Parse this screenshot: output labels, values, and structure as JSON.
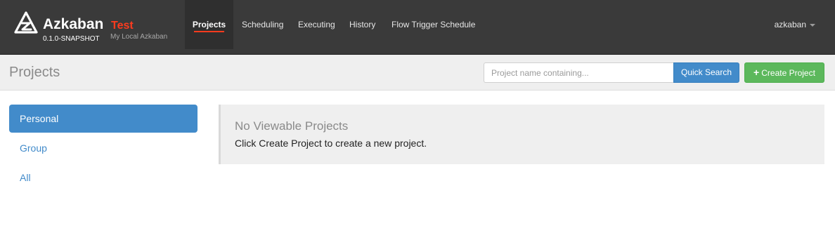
{
  "brand": {
    "name": "Azkaban",
    "env": "Test",
    "version": "0.1.0-SNAPSHOT",
    "description": "My Local Azkaban",
    "logo_icon": "azkaban-logo-icon"
  },
  "nav": {
    "items": [
      {
        "label": "Projects",
        "active": true
      },
      {
        "label": "Scheduling",
        "active": false
      },
      {
        "label": "Executing",
        "active": false
      },
      {
        "label": "History",
        "active": false
      },
      {
        "label": "Flow Trigger Schedule",
        "active": false
      }
    ],
    "user": "azkaban"
  },
  "header": {
    "title": "Projects",
    "search_placeholder": "Project name containing...",
    "search_value": "",
    "quick_search_label": "Quick Search",
    "create_project_label": "Create Project"
  },
  "sidebar": {
    "items": [
      {
        "label": "Personal",
        "active": true
      },
      {
        "label": "Group",
        "active": false
      },
      {
        "label": "All",
        "active": false
      }
    ]
  },
  "main": {
    "empty_title": "No Viewable Projects",
    "empty_text": "Click Create Project to create a new project."
  },
  "colors": {
    "navbar": "#3a3a3a",
    "accent_red": "#ff3b1e",
    "primary_blue": "#428bca",
    "success_green": "#5cb85c"
  }
}
